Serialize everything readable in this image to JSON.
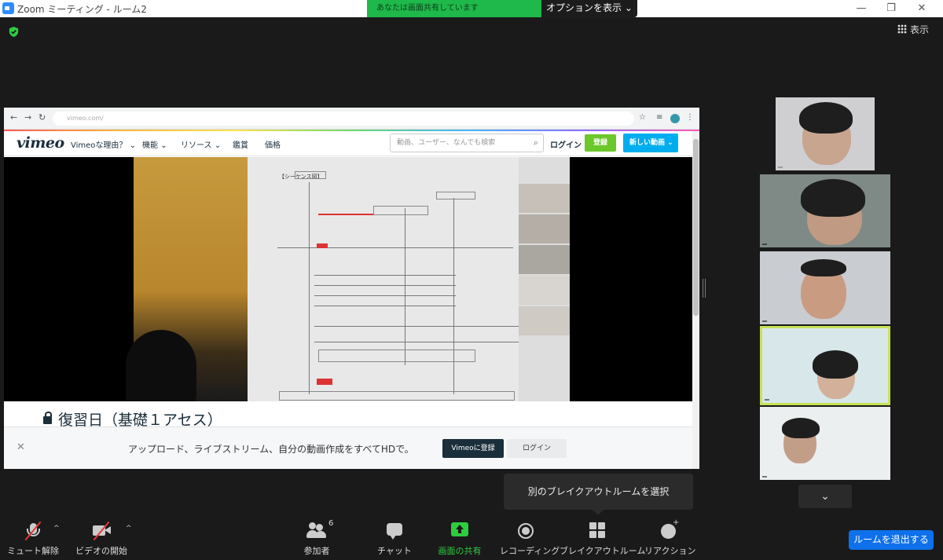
{
  "window": {
    "title": "Zoom ミーティング - ルーム2",
    "share_banner": "あなたは画面共有しています",
    "options_label": "オプションを表示",
    "view_label": "表示"
  },
  "browser": {
    "url": "vimeo.com/",
    "vimeo": {
      "logo": "vimeo",
      "nav_items": [
        "Vimeoな理由？",
        "機能",
        "リソース",
        "鑑賞",
        "価格"
      ],
      "search_placeholder": "動画、ユーザー、なんでも検索",
      "login": "ログイン",
      "join": "登録",
      "new_video": "新しい動画",
      "video_title": "復習日（基礎１アセス）",
      "paper_title": "【シーケンス図】",
      "banner_message": "アップロード、ライブストリーム、自分の動画作成をすべてHDで。",
      "banner_join": "Vimeoに登録",
      "banner_login": "ログイン"
    }
  },
  "breakout_popup": "別のブレイクアウトルームを選択",
  "toolbar": {
    "mute": "ミュート解除",
    "video": "ビデオの開始",
    "participants": "参加者",
    "participants_count": "6",
    "chat": "チャット",
    "share": "画面の共有",
    "record": "レコーディング",
    "breakout": "ブレイクアウトルーム",
    "reactions": "リアクション",
    "leave": "ルームを退出する"
  },
  "colors": {
    "share_green": "#2ecc40",
    "leave_blue": "#0e71eb",
    "active_speaker": "#c7e257",
    "muted_red": "#e53935"
  }
}
